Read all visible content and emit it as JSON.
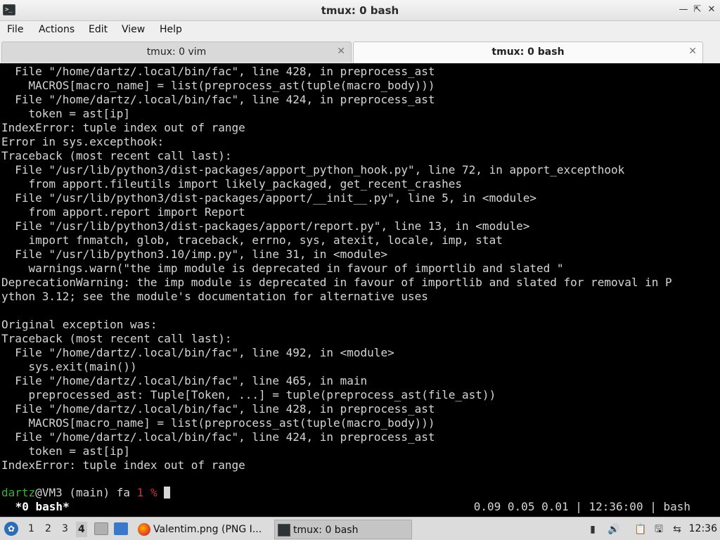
{
  "window": {
    "title": "tmux: 0 bash",
    "app_icon_text": ">_",
    "controls": [
      "minimize",
      "maximize",
      "close"
    ]
  },
  "menu": [
    "File",
    "Actions",
    "Edit",
    "View",
    "Help"
  ],
  "tabs": [
    {
      "label": "tmux: 0 vim",
      "active": false
    },
    {
      "label": "tmux: 0 bash",
      "active": true
    }
  ],
  "terminal": {
    "lines": [
      "  File \"/home/dartz/.local/bin/fac\", line 428, in preprocess_ast",
      "    MACROS[macro_name] = list(preprocess_ast(tuple(macro_body)))",
      "  File \"/home/dartz/.local/bin/fac\", line 424, in preprocess_ast",
      "    token = ast[ip]",
      "IndexError: tuple index out of range",
      "Error in sys.excepthook:",
      "Traceback (most recent call last):",
      "  File \"/usr/lib/python3/dist-packages/apport_python_hook.py\", line 72, in apport_excepthook",
      "    from apport.fileutils import likely_packaged, get_recent_crashes",
      "  File \"/usr/lib/python3/dist-packages/apport/__init__.py\", line 5, in <module>",
      "    from apport.report import Report",
      "  File \"/usr/lib/python3/dist-packages/apport/report.py\", line 13, in <module>",
      "    import fnmatch, glob, traceback, errno, sys, atexit, locale, imp, stat",
      "  File \"/usr/lib/python3.10/imp.py\", line 31, in <module>",
      "    warnings.warn(\"the imp module is deprecated in favour of importlib and slated \"",
      "DeprecationWarning: the imp module is deprecated in favour of importlib and slated for removal in P",
      "ython 3.12; see the module's documentation for alternative uses",
      "",
      "Original exception was:",
      "Traceback (most recent call last):",
      "  File \"/home/dartz/.local/bin/fac\", line 492, in <module>",
      "    sys.exit(main())",
      "  File \"/home/dartz/.local/bin/fac\", line 465, in main",
      "    preprocessed_ast: Tuple[Token, ...] = tuple(preprocess_ast(file_ast))",
      "  File \"/home/dartz/.local/bin/fac\", line 428, in preprocess_ast",
      "    MACROS[macro_name] = list(preprocess_ast(tuple(macro_body)))",
      "  File \"/home/dartz/.local/bin/fac\", line 424, in preprocess_ast",
      "    token = ast[ip]",
      "IndexError: tuple index out of range",
      ""
    ],
    "prompt": {
      "user": "dartz",
      "host": "@VM3 (main) fa ",
      "exit_code": "1",
      "symbol": " % "
    },
    "status_left": " *0 bash*",
    "status_right": "0.09 0.05 0.01 | 12:36:00 | bash"
  },
  "taskbar": {
    "workspaces": [
      "1",
      "2",
      "3",
      "4"
    ],
    "current_workspace": "4",
    "tasks": [
      {
        "label": "Valentim.png (PNG I...",
        "icon": "firefox-icon",
        "active": false
      },
      {
        "label": "tmux: 0 bash",
        "icon": "terminal-icon",
        "active": true
      }
    ],
    "clock": "12:36"
  },
  "colors": {
    "prompt_user": "#3fae3f",
    "prompt_error": "#cc3333",
    "terminal_bg": "#000000",
    "terminal_fg": "#d6d6d6"
  }
}
